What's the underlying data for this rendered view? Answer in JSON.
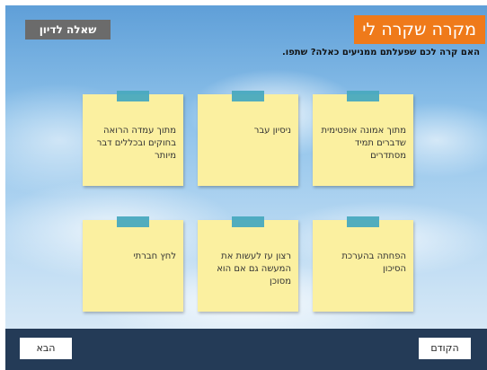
{
  "header": {
    "title": "מקרה שקרה לי",
    "discussion_button": "שאלה לדיון",
    "question": "האם קרה לכם שפעלתם ממניעים כאלה? שתפו."
  },
  "notes": [
    {
      "text": "מתוך אמונה אופטימית שדברים תמיד מסתדרים"
    },
    {
      "text": "ניסיון עבר"
    },
    {
      "text": "מתוך עמדה הרואה בחוקים ובכללים דבר מיותר"
    },
    {
      "text": "הפחתה בהערכת הסיכון"
    },
    {
      "text": "רצון עז לעשות את המעשה גם אם הוא מסוכן"
    },
    {
      "text": "לחץ חברתי"
    }
  ],
  "footer": {
    "prev_label": "הקודם",
    "next_label": "הבא"
  },
  "colors": {
    "title_bg": "#ef7a1a",
    "discussion_bg": "#6b6b6b",
    "note_bg": "#fbf0a0",
    "tape": "#49a9bf",
    "footer_bg": "#243b57"
  }
}
